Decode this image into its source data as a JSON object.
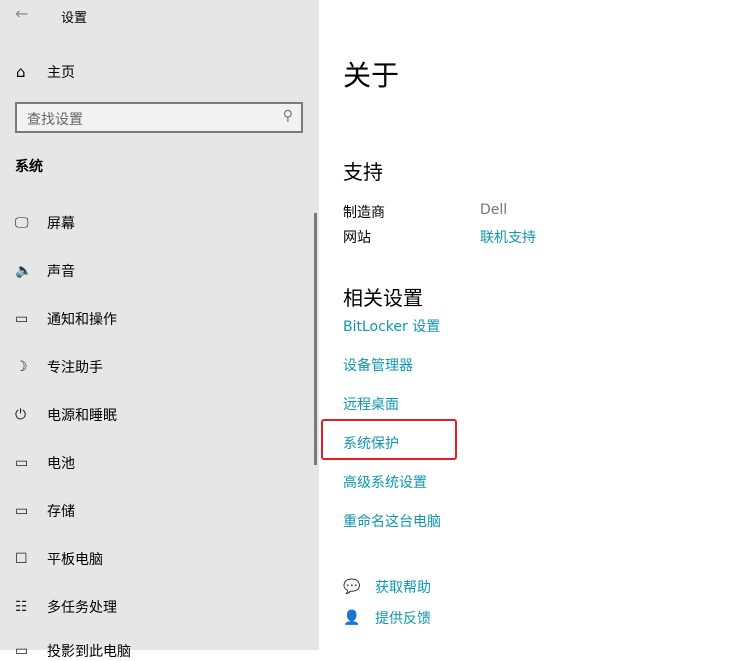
{
  "window": {
    "back_icon": "←",
    "title": "设置"
  },
  "sidebar": {
    "home": "主页",
    "search_placeholder": "查找设置",
    "section": "系统",
    "items": [
      {
        "label": "屏幕",
        "icon": "🖵"
      },
      {
        "label": "声音",
        "icon": "🔈"
      },
      {
        "label": "通知和操作",
        "icon": "▭"
      },
      {
        "label": "专注助手",
        "icon": "☽"
      },
      {
        "label": "电源和睡眠",
        "icon": "⏻"
      },
      {
        "label": "电池",
        "icon": "▭"
      },
      {
        "label": "存储",
        "icon": "▭"
      },
      {
        "label": "平板电脑",
        "icon": "☐"
      },
      {
        "label": "多任务处理",
        "icon": "☷"
      },
      {
        "label": "投影到此电脑",
        "icon": "▭"
      }
    ]
  },
  "main": {
    "title": "关于",
    "support": {
      "heading": "支持",
      "manufacturer_label": "制造商",
      "manufacturer_value": "Dell",
      "website_label": "网站",
      "website_value": "联机支持"
    },
    "related": {
      "heading": "相关设置",
      "links": [
        "BitLocker 设置",
        "设备管理器",
        "远程桌面",
        "系统保护",
        "高级系统设置",
        "重命名这台电脑"
      ]
    },
    "help": {
      "get_help": "获取帮助",
      "feedback": "提供反馈"
    },
    "highlight_color": "#e02020"
  }
}
